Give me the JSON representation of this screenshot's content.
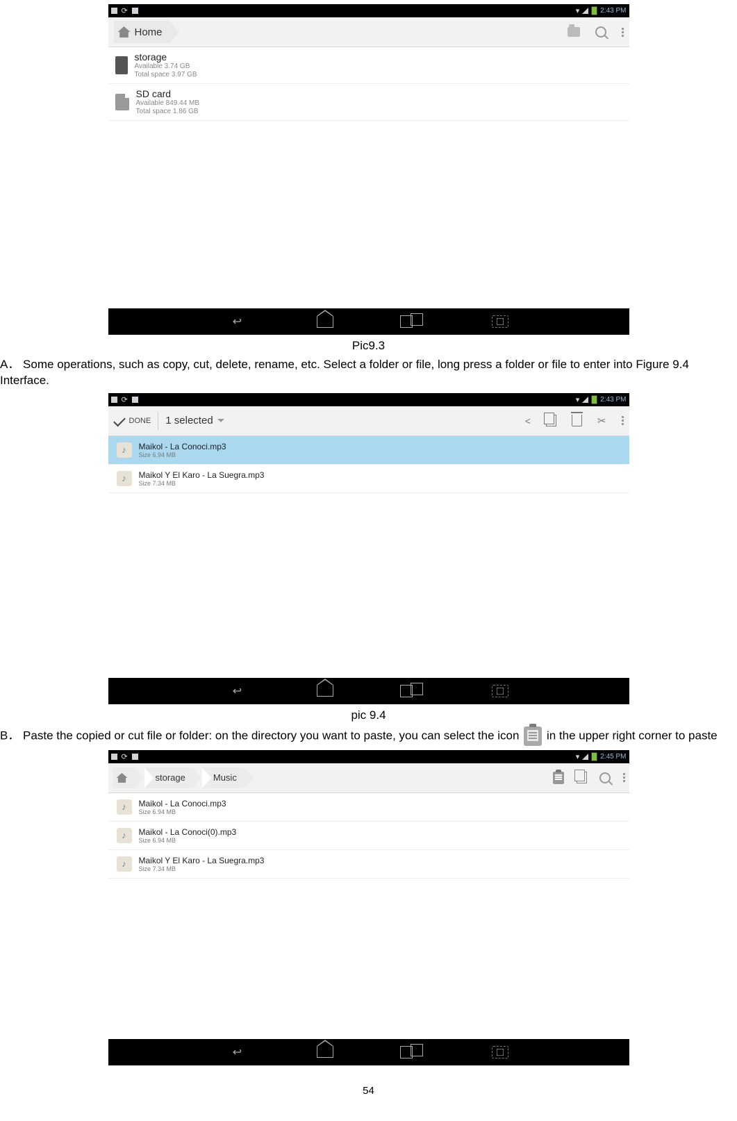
{
  "page_number": "54",
  "captions": {
    "pic93": "Pic9.3",
    "pic94": "pic 9.4"
  },
  "paragraphs": {
    "A": "A．  Some operations, such as copy, cut, delete, rename, etc. Select a folder or file, long press a folder or file to enter into Figure 9.4 Interface.",
    "B_pre": "B．  Paste the copied or cut file or folder: on the directory you want to paste, you can select the icon ",
    "B_post": " in the upper right corner to paste"
  },
  "shot1": {
    "time": "2:43 PM",
    "breadcrumb_home": "Home",
    "items": [
      {
        "name": "storage",
        "line1": "Available 3.74 GB",
        "line2": "Total space 3.97 GB"
      },
      {
        "name": "SD card",
        "line1": "Available 849.44 MB",
        "line2": "Total space 1.86 GB"
      }
    ]
  },
  "shot2": {
    "time": "2:43 PM",
    "done": "DONE",
    "selected": "1 selected",
    "rows": [
      {
        "name": "Maikol - La Conoci.mp3",
        "size": "Size 6.94 MB",
        "selected": true
      },
      {
        "name": "Maikol Y El Karo - La Suegra.mp3",
        "size": "Size 7.34 MB",
        "selected": false
      }
    ]
  },
  "shot3": {
    "time": "2:45 PM",
    "crumbs": {
      "c1": "",
      "c2": "storage",
      "c3": "Music"
    },
    "rows": [
      {
        "name": "Maikol - La Conoci.mp3",
        "size": "Size 6.94 MB"
      },
      {
        "name": "Maikol - La Conoci(0).mp3",
        "size": "Size 6.94 MB"
      },
      {
        "name": "Maikol Y El Karo - La Suegra.mp3",
        "size": "Size 7.34 MB"
      }
    ]
  }
}
